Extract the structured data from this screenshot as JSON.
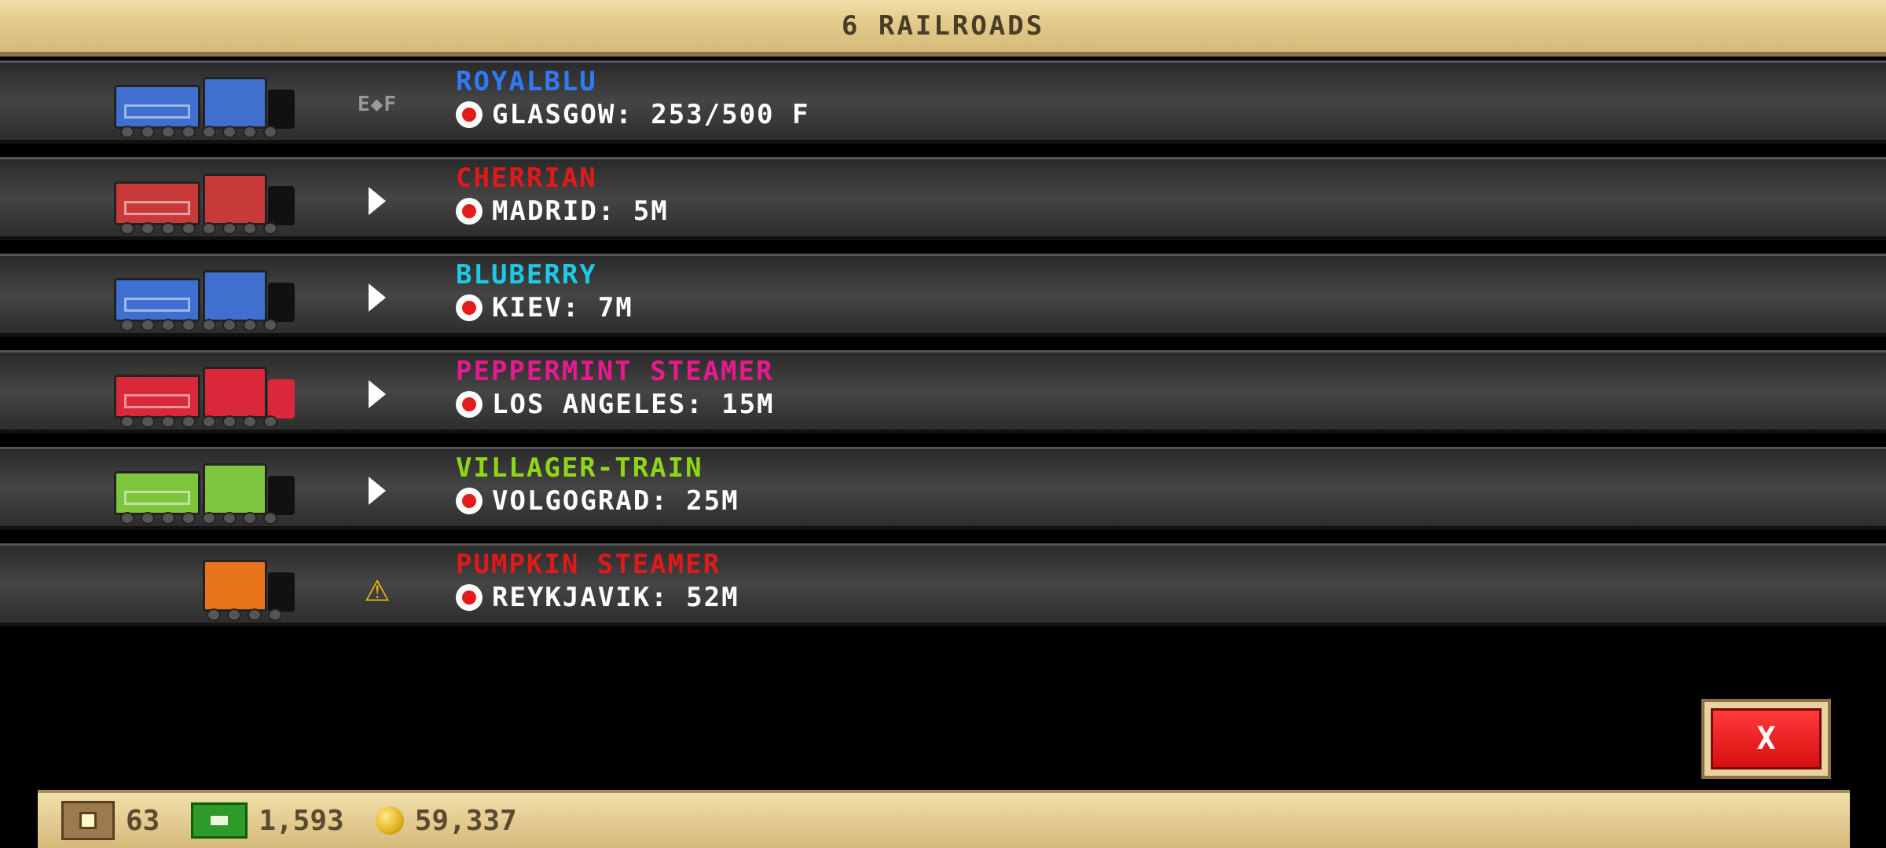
{
  "header": {
    "title": "6 RAILROADS"
  },
  "railroads": [
    {
      "name": "ROYALBLU",
      "name_color": "#2f7bf5",
      "destination": "GLASGOW: 253/500 F",
      "status": "E-F",
      "train_color": "#3f6fcf",
      "has_tender": true
    },
    {
      "name": "CHERRIAN",
      "name_color": "#e0191b",
      "destination": "MADRID: 5M",
      "status": "play",
      "train_color": "#c83a3a",
      "has_tender": true
    },
    {
      "name": "BLUBERRY",
      "name_color": "#1ec9e6",
      "destination": "KIEV: 7M",
      "status": "play",
      "train_color": "#3f6fcf",
      "has_tender": true
    },
    {
      "name": "PEPPERMINT STEAMER",
      "name_color": "#e8198c",
      "destination": "LOS ANGELES: 15M",
      "status": "play",
      "train_color": "#d9283a",
      "has_tender": true
    },
    {
      "name": "VILLAGER-TRAIN",
      "name_color": "#8fd615",
      "destination": "VOLGOGRAD: 25M",
      "status": "play",
      "train_color": "#7fc43d",
      "has_tender": true
    },
    {
      "name": "PUMPKIN STEAMER",
      "name_color": "#e0191b",
      "destination": "REYKJAVIK: 52M",
      "status": "warning",
      "train_color": "#e8741c",
      "has_tender": false
    }
  ],
  "status_icons": {
    "ef_label": "E◆F",
    "warning_label": "⚠"
  },
  "close_button": {
    "label": "X"
  },
  "footer": {
    "crates": "63",
    "cash": "1,593",
    "coins": "59,337"
  }
}
